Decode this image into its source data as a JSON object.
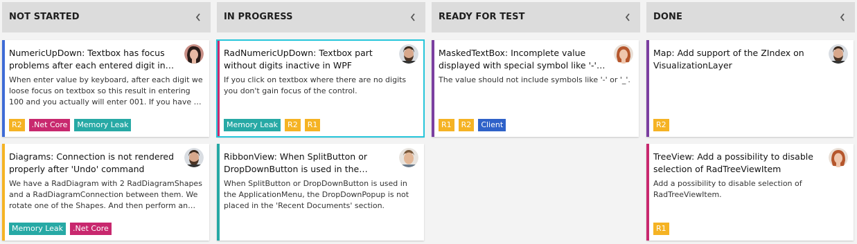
{
  "colors": {
    "header_bg": "#dcdcdc",
    "board_bg": "#f3f3f3",
    "selected_outline": "#26c6da",
    "tag_r1": "#f5b324",
    "tag_r2": "#f5b324",
    "tag_netcore": "#c8286e",
    "tag_memoryleak": "#27a9a5",
    "tag_client": "#2f62c9"
  },
  "columns": [
    {
      "title": "NOT STARTED",
      "cards": [
        {
          "title": "NumericUpDown: Textbox has focus problems after each entered digit in WPF",
          "description": "When enter value by keyboard, after each digit we loose focus on textbox so this result in entering 100 and you actually will enter 001. If you have $ symbol in the format...",
          "accent": "#3e6bd6",
          "avatar": "female-dark-hair",
          "tags": [
            "R2",
            ".Net Core",
            "Memory Leak"
          ]
        },
        {
          "title": "Diagrams: Connection is not rendered properly after 'Undo' command",
          "description": "We have a RadDiagram with 2 RadDiagramShapes and a RadDiagramConnection between them. We rotate one of the Shapes. And then perform an 'Undo' command...",
          "accent": "#f5b324",
          "avatar": "male-beard",
          "tags": [
            "Memory Leak",
            ".Net Core"
          ]
        }
      ]
    },
    {
      "title": "IN PROGRESS",
      "cards": [
        {
          "title": "RadNumericUpDown: Textbox part without digits inactive in WPF",
          "description": "If you click on textbox where there are no digits you don't gain focus of the control.",
          "accent": "#c8286e",
          "avatar": "male-beard",
          "tags": [
            "Memory Leak",
            "R2",
            "R1"
          ]
        },
        {
          "title": "RibbonView: When SplitButton or DropDownButton is used in the ApplicationMenu...",
          "description": "When SplitButton or DropDownButton is used in the ApplicationMenu, the DropDownPopup is not placed in the 'Recent Documents' section.",
          "accent": "#27a9a5",
          "avatar": "male-light",
          "tags": []
        }
      ]
    },
    {
      "title": "READY FOR TEST",
      "cards": [
        {
          "title": "MaskedTextBox: Incomplete value displayed with special symbol like '-' and '_'",
          "description": "The value should not include symbols like '-' or '_'.",
          "accent": "#7b3fa0",
          "avatar": "female-red-hair",
          "tags": [
            "R1",
            "R2",
            "Client"
          ]
        }
      ]
    },
    {
      "title": "DONE",
      "cards": [
        {
          "title": "Map: Add support of the ZIndex on VisualizationLayer",
          "description": "",
          "accent": "#7b3fa0",
          "avatar": "male-beard",
          "tags": [
            "R2"
          ]
        },
        {
          "title": "TreeView: Add a possibility to disable selection of RadTreeViewItem",
          "description": "Add a possibility to disable selection of RadTreeViewItem.",
          "accent": "#c8286e",
          "avatar": "female-red-hair",
          "tags": [
            "R1"
          ]
        }
      ]
    }
  ]
}
